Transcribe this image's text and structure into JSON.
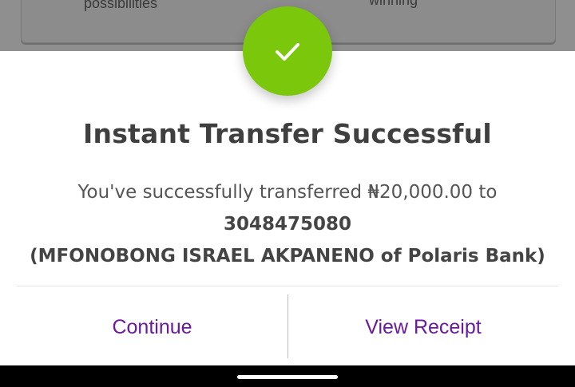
{
  "background": {
    "left_text": "possibilities",
    "right_text": "winning"
  },
  "dialog": {
    "status_icon": "checkmark-icon",
    "accent_color": "#7ac70c",
    "title": "Instant Transfer Successful",
    "message_prefix": "You've successfully transferred ",
    "amount": "₦20,000.00",
    "message_to": " to ",
    "account_number": "3048475080",
    "recipient": "(MFONOBONG ISRAEL AKPANENO of Polaris Bank)",
    "continue_label": "Continue",
    "view_receipt_label": "View Receipt",
    "action_color": "#6a1b9a"
  }
}
